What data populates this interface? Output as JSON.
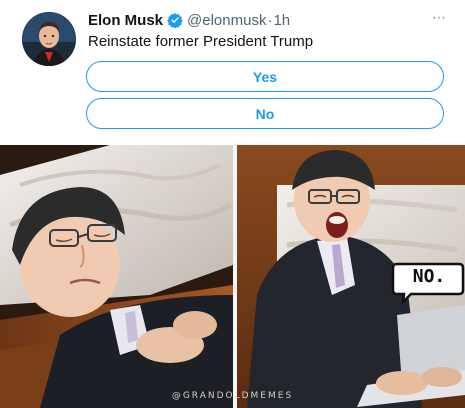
{
  "tweet": {
    "display_name": "Elon Musk",
    "handle": "@elonmusk",
    "separator": "·",
    "time": "1h",
    "more_icon": "⋯",
    "text": "Reinstate former President Trump",
    "verified_icon": "verified-badge-icon",
    "poll": {
      "options": [
        {
          "label": "Yes"
        },
        {
          "label": "No"
        }
      ]
    }
  },
  "meme": {
    "speech_bubble": "NO.",
    "watermark": "@GRANDOLDMEMES"
  },
  "colors": {
    "accent": "#1d9bf0",
    "text": "#0f1419",
    "muted": "#536471"
  }
}
